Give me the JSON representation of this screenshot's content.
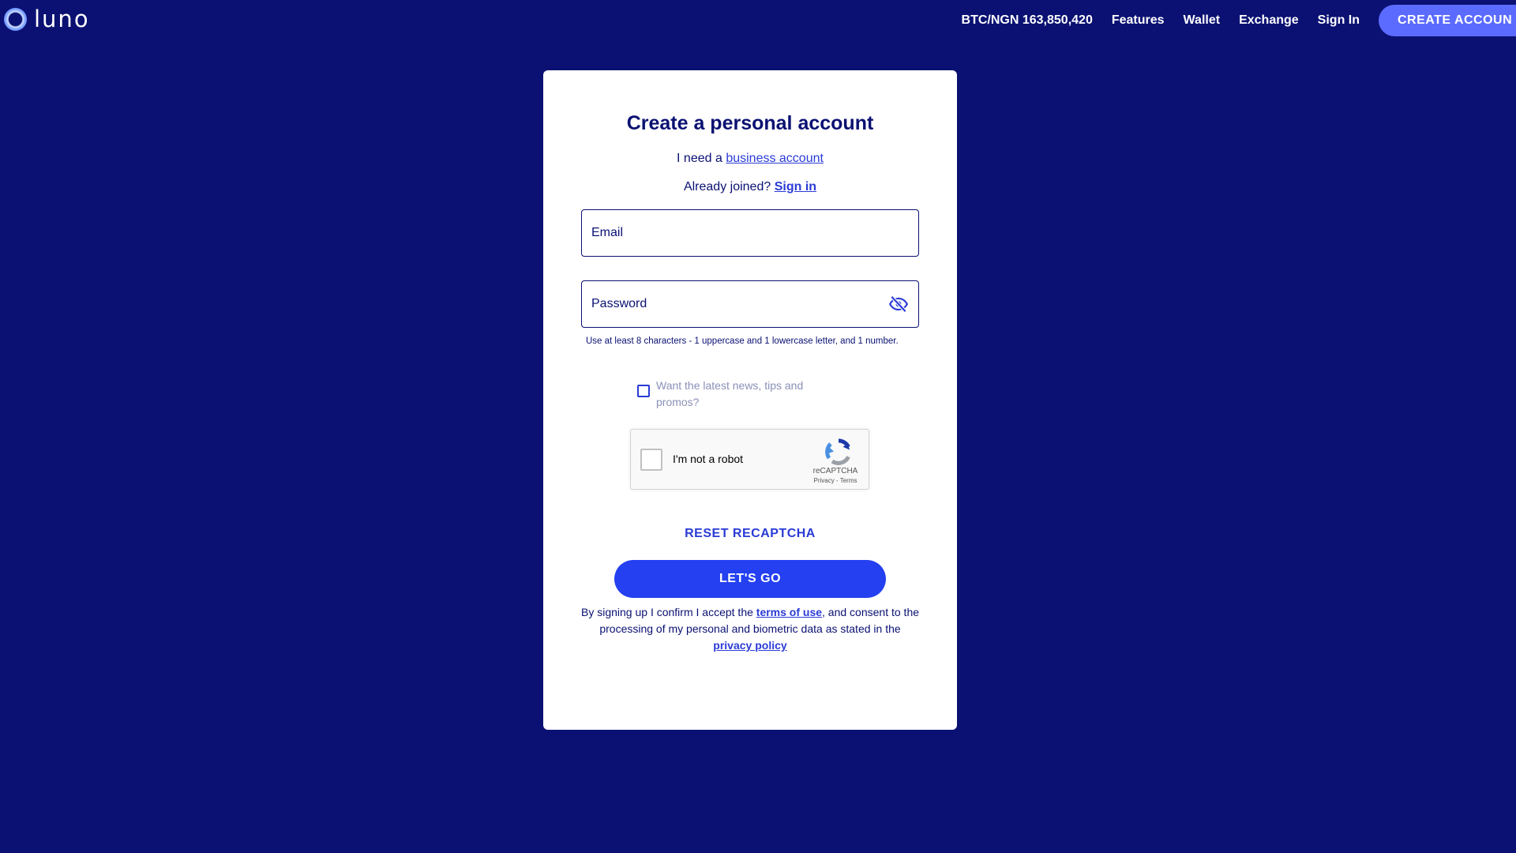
{
  "brand": {
    "name": "luno"
  },
  "nav": {
    "price": "BTC/NGN 163,850,420",
    "items": [
      "Features",
      "Wallet",
      "Exchange",
      "Sign In"
    ],
    "cta": "CREATE ACCOUN"
  },
  "form": {
    "title": "Create a personal account",
    "business_prefix": "I need a ",
    "business_link": "business account",
    "joined_prefix": "Already joined? ",
    "signin_link": "Sign in",
    "email_placeholder": "Email",
    "password_placeholder": "Password",
    "password_hint": "Use at least 8 characters - 1 uppercase and 1 lowercase letter, and 1 number.",
    "promo_label": "Want the latest news, tips and promos?",
    "recaptcha": {
      "label": "I'm not a robot",
      "brand": "reCAPTCHA",
      "links": "Privacy - Terms"
    },
    "reset_label": "RESET RECAPTCHA",
    "submit_label": "LET'S GO",
    "legal_prefix": "By signing up I confirm I accept the ",
    "terms_link": "terms of use",
    "legal_middle": ", and consent to the processing of my personal and biometric data as stated in the ",
    "privacy_link": "privacy policy"
  },
  "colors": {
    "background": "#0a1172",
    "accent": "#2440f0",
    "cta": "#5b6bff",
    "link": "#2a3bd6"
  }
}
